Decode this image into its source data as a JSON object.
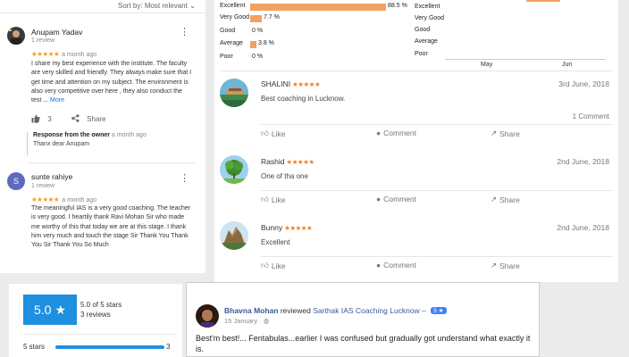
{
  "google": {
    "sort_label": "Sort by:",
    "sort_value": "Most relevant",
    "reviews": [
      {
        "name": "Anupam Yadav",
        "meta": "1 review",
        "stars": "★★★★★",
        "time": "a month ago",
        "text": "I share my best experience with the institute. The faculty are very skilled and friendly. They always make sure that I get time and attention on my subject. The environment is also very competitive over here , they also conduct the test ...",
        "more": "More",
        "likes": "3",
        "share": "Share",
        "response_header": "Response from the owner",
        "response_time": "a month ago",
        "response_text": "Thanx dear Anupam"
      },
      {
        "name": "sunte rahiye",
        "initial": "S",
        "meta": "1 review",
        "stars": "★★★★★",
        "time": "a month ago",
        "text": "The meaningful IAS is a very good coaching. The teacher is very good. I heartily thank Ravi Mohan Sir who made me worthy of this that today we are at this stage. I thank him very much and touch the stage Sir Thank You Thank You Sir Thank You So Much"
      }
    ]
  },
  "ratings": {
    "rows": [
      {
        "label": "Excellent",
        "pct_text": "88.5 %",
        "value": 88.5
      },
      {
        "label": "Very Good",
        "pct_text": "7.7 %",
        "value": 7.7
      },
      {
        "label": "Good",
        "pct_text": "0 %",
        "value": 0
      },
      {
        "label": "Average",
        "pct_text": "3.8 %",
        "value": 3.8
      },
      {
        "label": "Poor",
        "pct_text": "0 %",
        "value": 0
      }
    ]
  },
  "minichart": {
    "labels": [
      "Excellent",
      "Very Good",
      "Good",
      "Average",
      "Poor"
    ],
    "months": [
      "May",
      "Jun"
    ]
  },
  "reviews": [
    {
      "name": "SHALINI",
      "stars": "★★★★★",
      "date": "3rd June, 2018",
      "body": "Best coaching in Lucknow.",
      "comments": "1 Comment",
      "like": "Like",
      "comment": "Comment",
      "share": "Share"
    },
    {
      "name": "Rashid",
      "stars": "★★★★★",
      "date": "2nd June, 2018",
      "body": "One of tha one",
      "like": "Like",
      "comment": "Comment",
      "share": "Share"
    },
    {
      "name": "Bunny",
      "stars": "★★★★★",
      "date": "2nd June, 2018",
      "body": "Excellent",
      "like": "Like",
      "comment": "Comment",
      "share": "Share"
    }
  ],
  "summary": {
    "score": "5.0",
    "star": "★",
    "line1": "5.0 of 5 stars",
    "line2": "3 reviews",
    "row_label": "5 stars",
    "row_count": "3",
    "row_fraction": 1.0
  },
  "facebook": {
    "name": "Bhavna Mohan",
    "action": "reviewed",
    "page": "Sarthak IAS Coaching Lucknow –",
    "badge": "5 ★",
    "date": "15 January · ",
    "text": "Best'm best!... Fentabulas...earlier I was confused but gradually got understand what exactly it is."
  },
  "colors": {
    "rating_bar": "#f4a062",
    "google_star": "#f0a020",
    "summary_blue": "#1f8fe0",
    "fb_blue": "#3b5998"
  }
}
